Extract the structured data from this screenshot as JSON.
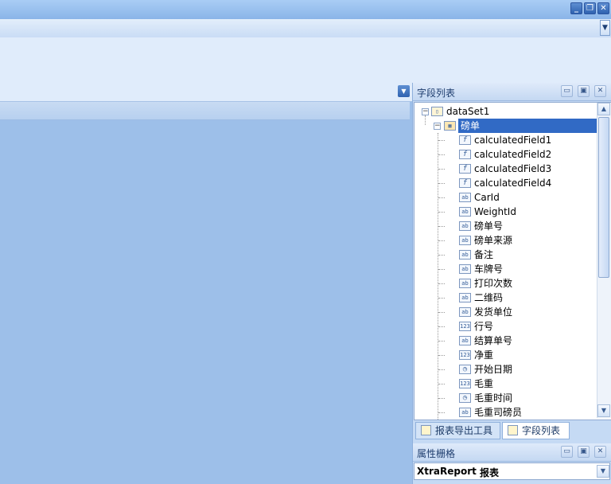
{
  "window": {
    "buttons": {
      "minimize": "_",
      "restore": "❐",
      "close": "✕"
    }
  },
  "field_list": {
    "title": "字段列表",
    "dataset": "dataSet1",
    "table": "磅单",
    "fields": [
      {
        "icon": "function-icon",
        "glyph": "f",
        "label": "calculatedField1"
      },
      {
        "icon": "function-icon",
        "glyph": "f",
        "label": "calculatedField2"
      },
      {
        "icon": "function-icon",
        "glyph": "f",
        "label": "calculatedField3"
      },
      {
        "icon": "function-icon",
        "glyph": "f",
        "label": "calculatedField4"
      },
      {
        "icon": "string-field-icon",
        "glyph": "ab",
        "label": "CarId"
      },
      {
        "icon": "string-field-icon",
        "glyph": "ab",
        "label": "WeightId"
      },
      {
        "icon": "string-field-icon",
        "glyph": "ab",
        "label": "磅单号"
      },
      {
        "icon": "string-field-icon",
        "glyph": "ab",
        "label": "磅单来源"
      },
      {
        "icon": "string-field-icon",
        "glyph": "ab",
        "label": "备注"
      },
      {
        "icon": "string-field-icon",
        "glyph": "ab",
        "label": "车牌号"
      },
      {
        "icon": "string-field-icon",
        "glyph": "ab",
        "label": "打印次数"
      },
      {
        "icon": "string-field-icon",
        "glyph": "ab",
        "label": "二维码"
      },
      {
        "icon": "string-field-icon",
        "glyph": "ab",
        "label": "发货单位"
      },
      {
        "icon": "number-field-icon",
        "glyph": "123",
        "label": "行号"
      },
      {
        "icon": "string-field-icon",
        "glyph": "ab",
        "label": "结算单号"
      },
      {
        "icon": "number-field-icon",
        "glyph": "123",
        "label": "净重"
      },
      {
        "icon": "datetime-field-icon",
        "glyph": "◷",
        "label": "开始日期"
      },
      {
        "icon": "number-field-icon",
        "glyph": "123",
        "label": "毛重"
      },
      {
        "icon": "datetime-field-icon",
        "glyph": "◷",
        "label": "毛重时间"
      },
      {
        "icon": "string-field-icon",
        "glyph": "ab",
        "label": "毛重司磅员"
      }
    ],
    "scroll_position": 0.2
  },
  "tabs": [
    {
      "label": "报表导出工具",
      "active": false
    },
    {
      "label": "字段列表",
      "active": true
    }
  ],
  "property_grid": {
    "title": "属性栅格",
    "selected_object": "XtraReport",
    "selected_type": "报表"
  },
  "colors": {
    "canvas": "#9dbfe9",
    "selected_row": "#316ac5",
    "selected_text": "#ffffff"
  }
}
